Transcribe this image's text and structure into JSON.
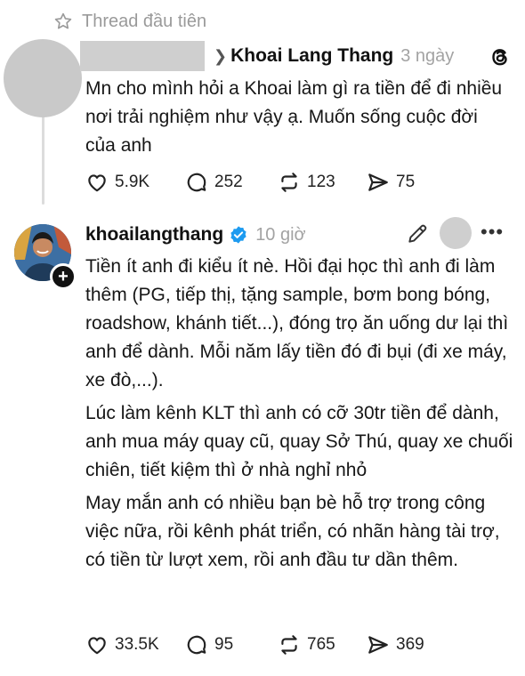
{
  "pinned_label": "Thread đầu tiên",
  "post1": {
    "reply_to": "Khoai Lang Thang",
    "time": "3 ngày",
    "text": "Mn cho mình hỏi a Khoai làm gì ra tiền để đi nhiều nơi trải nghiệm như vậy ạ. Muốn sống cuộc đời của anh",
    "likes": "5.9K",
    "comments": "252",
    "reposts": "123",
    "shares": "75"
  },
  "post2": {
    "username": "khoailangthang",
    "time": "10 giờ",
    "paragraphs": [
      "Tiền ít anh đi kiểu ít nè. Hồi đại học thì anh đi làm thêm (PG, tiếp thị, tặng sample, bơm bong bóng, roadshow, khánh tiết...), đóng trọ ăn uống dư lại thì anh để dành. Mỗi năm lấy tiền đó đi bụi (đi xe máy, xe đò,...).",
      "Lúc làm kênh KLT thì anh có cỡ 30tr tiền để dành, anh mua máy quay cũ, quay Sở Thú, quay xe chuối chiên, tiết kiệm thì ở nhà nghỉ nhỏ",
      "May mắn anh có nhiều bạn bè hỗ trợ trong công việc nữa, rồi kênh phát triển, có nhãn hàng tài trợ, có tiền từ lượt xem, rồi anh đầu tư dần thêm."
    ],
    "likes": "33.5K",
    "comments": "95",
    "reposts": "765",
    "shares": "369"
  },
  "colors": {
    "verified_badge": "#1d9bf0",
    "muted_text": "#9a9a9a"
  },
  "icons": [
    "star-icon",
    "threads-logo-icon",
    "heart-icon",
    "comment-icon",
    "repost-icon",
    "share-icon",
    "verified-icon",
    "pencil-icon",
    "more-icon",
    "plus-icon"
  ]
}
